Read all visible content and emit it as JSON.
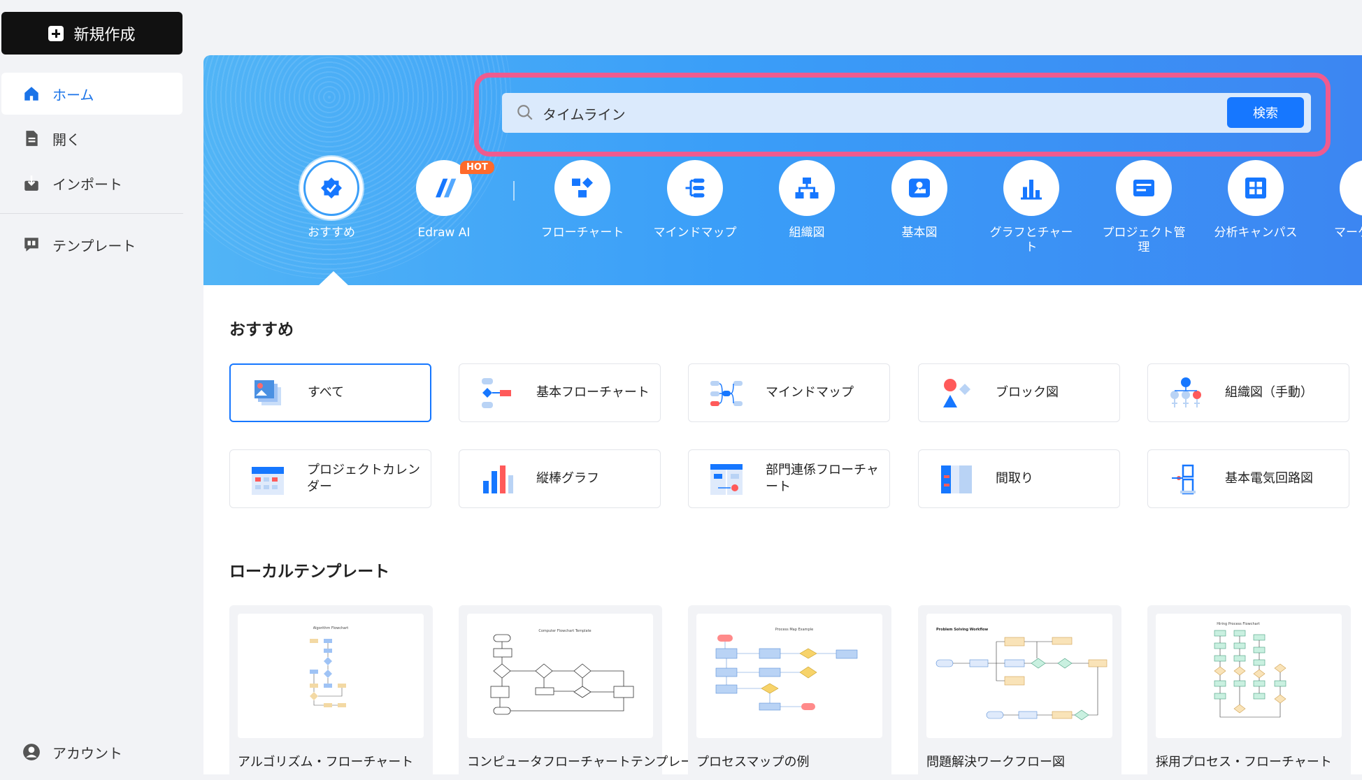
{
  "sidebar": {
    "new_button": "新規作成",
    "items": [
      {
        "label": "ホーム",
        "icon": "home-icon"
      },
      {
        "label": "開く",
        "icon": "file-icon"
      },
      {
        "label": "インポート",
        "icon": "import-icon"
      },
      {
        "label": "テンプレート",
        "icon": "template-icon"
      }
    ],
    "account": "アカウント"
  },
  "search": {
    "value": "タイムライン",
    "button": "検索"
  },
  "categories": [
    {
      "label": "おすすめ",
      "icon": "badge-icon"
    },
    {
      "label": "Edraw AI",
      "icon": "edraw-ai-icon",
      "badge": "HOT"
    },
    {
      "label": "フローチャート",
      "icon": "flowchart-icon"
    },
    {
      "label": "マインドマップ",
      "icon": "mindmap-icon"
    },
    {
      "label": "組織図",
      "icon": "org-chart-icon"
    },
    {
      "label": "基本図",
      "icon": "basic-shapes-icon"
    },
    {
      "label": "グラフとチャート",
      "icon": "bar-chart-icon"
    },
    {
      "label": "プロジェクト管理",
      "icon": "project-icon"
    },
    {
      "label": "分析キャンパス",
      "icon": "canvas-icon"
    },
    {
      "label": "マーケ",
      "icon": "marketing-icon"
    }
  ],
  "recommended": {
    "title": "おすすめ",
    "cards": [
      {
        "label": "すべて",
        "icon": "all-templates-icon"
      },
      {
        "label": "基本フローチャート",
        "icon": "basic-flowchart-icon"
      },
      {
        "label": "マインドマップ",
        "icon": "mindmap-icon"
      },
      {
        "label": "ブロック図",
        "icon": "block-diagram-icon"
      },
      {
        "label": "組織図（手動）",
        "icon": "org-chart-icon"
      },
      {
        "label": "プロジェクトカレンダー",
        "icon": "calendar-icon"
      },
      {
        "label": "縦棒グラフ",
        "icon": "column-chart-icon"
      },
      {
        "label": "部門連係フローチャート",
        "icon": "cross-functional-icon"
      },
      {
        "label": "間取り",
        "icon": "floor-plan-icon"
      },
      {
        "label": "基本電気回路図",
        "icon": "circuit-icon"
      }
    ]
  },
  "local_templates": {
    "title": "ローカルテンプレート",
    "items": [
      {
        "label": "アルゴリズム・フローチャート",
        "thumb_title": "Algorithm Flowchart"
      },
      {
        "label": "コンピュータフローチャートテンプレート",
        "thumb_title": "Computer Flowchart Template"
      },
      {
        "label": "プロセスマップの例",
        "thumb_title": "Process Map Example"
      },
      {
        "label": "問題解決ワークフロー図",
        "thumb_title": "Problem Solving Workflow"
      },
      {
        "label": "採用プロセス・フローチャート",
        "thumb_title": "Hiring Process Flowchart"
      }
    ]
  },
  "colors": {
    "accent": "#1677ff",
    "highlight_outline": "#ef5b8f",
    "banner": "#3a9ef8"
  }
}
